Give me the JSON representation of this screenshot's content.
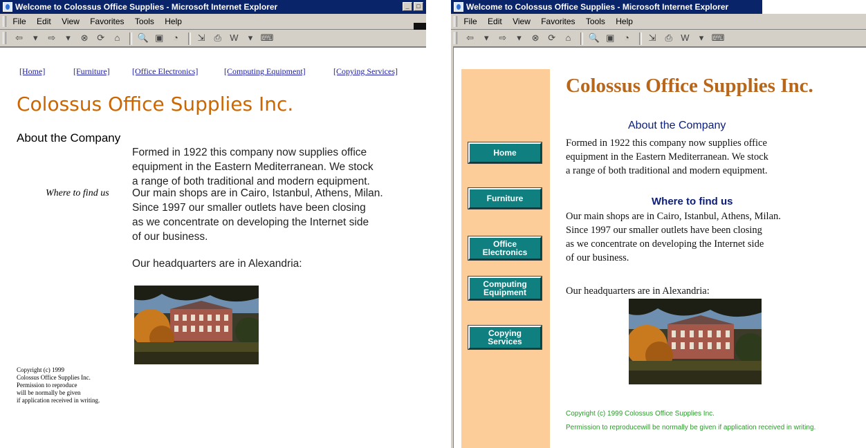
{
  "window_title": "Welcome to Colossus Office Supplies - Microsoft Internet Explorer",
  "menu": [
    "File",
    "Edit",
    "View",
    "Favorites",
    "Tools",
    "Help"
  ],
  "toolbar_glyphs": [
    "⇦",
    "▾",
    "⇨",
    "▾",
    "⊗",
    "⟳",
    "⌂",
    "🔍",
    "▣",
    "◔",
    "⇲",
    "⎙",
    "W",
    "▾",
    "⌨"
  ],
  "left_page": {
    "nav": [
      "[Home]",
      "[Furniture]",
      "[Office Electronics]",
      "[Computing Equipment]",
      "[Copying Services]"
    ],
    "title": "Colossus Office Supplies Inc.",
    "about_heading": "About the Company",
    "about_lines": [
      "Formed in 1922 this company now supplies office",
      "equipment in the Eastern Mediterranean. We stock",
      "a range of both traditional and modern equipment."
    ],
    "where_label": "Where to find us",
    "where_lines": [
      "Our main shops are in Cairo, Istanbul, Athens, Milan.",
      "Since 1997 our smaller outlets have been closing",
      "as we concentrate on developing the Internet side",
      "of our business."
    ],
    "hq": "Our headquarters are in Alexandria:",
    "copyright_lines": [
      "Copyright (c) 1999",
      "Colossus Office Supplies Inc.",
      "Permission to reproduce",
      "will be normally be given",
      "if application received in writing."
    ]
  },
  "right_page": {
    "nav": [
      "Home",
      "Furniture",
      "Office Electronics",
      "Computing Equipment",
      "Copying Services"
    ],
    "title": "Colossus Office Supplies Inc.",
    "about_heading": "About the Company",
    "about_lines": [
      "Formed in 1922 this company now supplies office",
      "equipment in the Eastern Mediterranean. We stock",
      "a range of both traditional and modern equipment."
    ],
    "where_heading": "Where to find us",
    "where_lines": [
      "Our main shops are in Cairo, Istanbul, Athens, Milan.",
      "Since 1997 our smaller outlets have been closing",
      "as we concentrate on developing the Internet side",
      "of our business."
    ],
    "hq": "Our headquarters are in Alexandria:",
    "copyright_lines": [
      "Copyright (c) 1999 Colossus Office Supplies Inc.",
      "Permission to reproducewill be normally be given if application received in writing."
    ]
  },
  "colors": {
    "titlebar": "#0a246a",
    "left_title": "#cc6600",
    "right_title": "#b8661a",
    "sidebar": "#fccc99",
    "nav_button": "#0f7f80",
    "heading_blue": "#0b1d7a",
    "copyright_green": "#2a9a2a"
  }
}
